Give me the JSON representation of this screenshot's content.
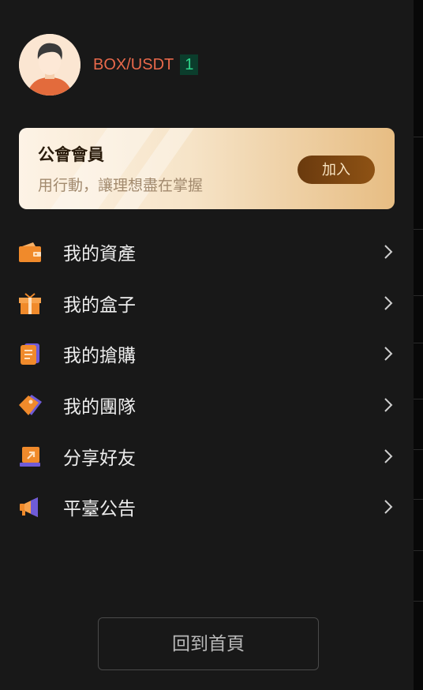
{
  "profile": {
    "pair": "BOX/USDT",
    "level": "1"
  },
  "member_card": {
    "title": "公會會員",
    "subtitle": "用行動，讓理想盡在掌握",
    "join_label": "加入"
  },
  "menu": [
    {
      "label": "我的資產",
      "icon": "wallet-icon"
    },
    {
      "label": "我的盒子",
      "icon": "gift-box-icon"
    },
    {
      "label": "我的搶購",
      "icon": "order-document-icon"
    },
    {
      "label": "我的團隊",
      "icon": "tag-icon"
    },
    {
      "label": "分享好友",
      "icon": "share-icon"
    },
    {
      "label": "平臺公告",
      "icon": "megaphone-icon"
    }
  ],
  "home_button": "回到首頁",
  "colors": {
    "background": "#181818",
    "accent_orange": "#f08a2b",
    "pair_text": "#e9694b",
    "badge_bg": "#0b3d2c",
    "badge_text": "#2ed48a"
  }
}
